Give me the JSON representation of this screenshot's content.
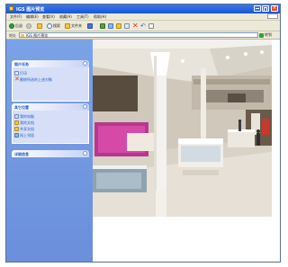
{
  "window": {
    "title": "IGS 图片预览"
  },
  "menubar": {
    "items": [
      "文件(F)",
      "编辑(E)",
      "查看(V)",
      "收藏(A)",
      "工具(T)",
      "帮助(H)"
    ]
  },
  "toolbar": {
    "back_label": "后退",
    "search_label": "搜索",
    "folders_label": "文件夹"
  },
  "addressbar": {
    "label": "地址",
    "value": "IGS 图片预览",
    "go_label": "转到"
  },
  "tasks": {
    "panel1": {
      "title": "图片任务",
      "items": [
        "打印",
        "删除所选的上述对象"
      ]
    },
    "panel2": {
      "title": "其它位置",
      "items": [
        "我的电脑",
        "我的文档",
        "共享文档",
        "网上邻居"
      ]
    },
    "panel3": {
      "title": "详细信息"
    }
  },
  "colors": {
    "title_bar": "#1c56d6",
    "task_pane": "#6b8fdb",
    "task_link": "#215dc6",
    "close_button": "#d9522b"
  }
}
